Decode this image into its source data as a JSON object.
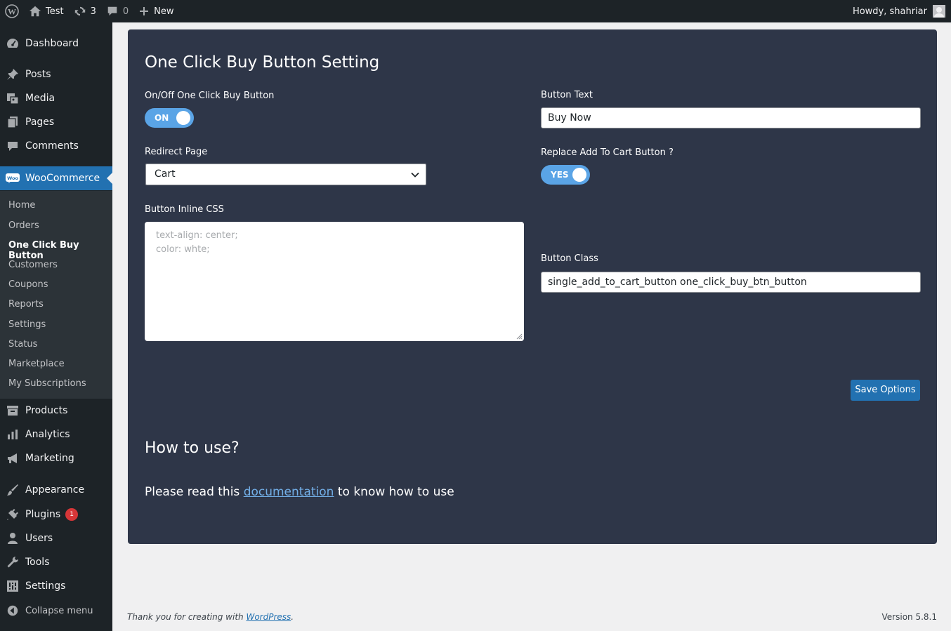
{
  "adminbar": {
    "site_name": "Test",
    "updates_count": "3",
    "comments_count": "0",
    "new_label": "New",
    "howdy": "Howdy, shahriar"
  },
  "sidebar": {
    "items": [
      {
        "label": "Dashboard",
        "icon": "dashboard-icon"
      },
      {
        "label": "Posts",
        "icon": "pin-icon"
      },
      {
        "label": "Media",
        "icon": "media-icon"
      },
      {
        "label": "Pages",
        "icon": "pages-icon"
      },
      {
        "label": "Comments",
        "icon": "comment-icon"
      },
      {
        "label": "WooCommerce",
        "icon": "woocommerce-icon"
      },
      {
        "label": "Products",
        "icon": "archive-icon"
      },
      {
        "label": "Analytics",
        "icon": "bar-chart-icon"
      },
      {
        "label": "Marketing",
        "icon": "megaphone-icon"
      },
      {
        "label": "Appearance",
        "icon": "brush-icon"
      },
      {
        "label": "Plugins",
        "icon": "plug-icon",
        "badge": "1"
      },
      {
        "label": "Users",
        "icon": "user-icon"
      },
      {
        "label": "Tools",
        "icon": "wrench-icon"
      },
      {
        "label": "Settings",
        "icon": "settings-icon"
      }
    ],
    "submenu": [
      "Home",
      "Orders",
      "One Click Buy Button",
      "Customers",
      "Coupons",
      "Reports",
      "Settings",
      "Status",
      "Marketplace",
      "My Subscriptions"
    ],
    "collapse_label": "Collapse menu"
  },
  "main": {
    "title": "One Click Buy Button Setting",
    "onoff_label": "On/Off One Click Buy Button",
    "onoff_value": "ON",
    "button_text_label": "Button Text",
    "button_text_value": "Buy Now",
    "redirect_label": "Redirect Page",
    "redirect_value": "Cart",
    "replace_label": "Replace Add To Cart Button ?",
    "replace_value": "YES",
    "inline_css_label": "Button Inline CSS",
    "inline_css_placeholder_line1": "text-align: center;",
    "inline_css_placeholder_line2": "color: whte;",
    "button_class_label": "Button Class",
    "button_class_value": "single_add_to_cart_button one_click_buy_btn_button",
    "save_label": "Save Options",
    "howto_title": "How to use?",
    "howto_prefix": "Please read this",
    "howto_link": "documentation",
    "howto_suffix": "to know how to use"
  },
  "footer": {
    "thanks_prefix": "Thank you for creating with",
    "thanks_link": "WordPress",
    "thanks_suffix": ".",
    "version": "Version 5.8.1"
  },
  "colors": {
    "admin_dark": "#1d2327",
    "accent_blue": "#2271b1",
    "panel_bg": "#2e3648",
    "toggle_blue": "#5aa4e6",
    "badge_red": "#d63638"
  }
}
